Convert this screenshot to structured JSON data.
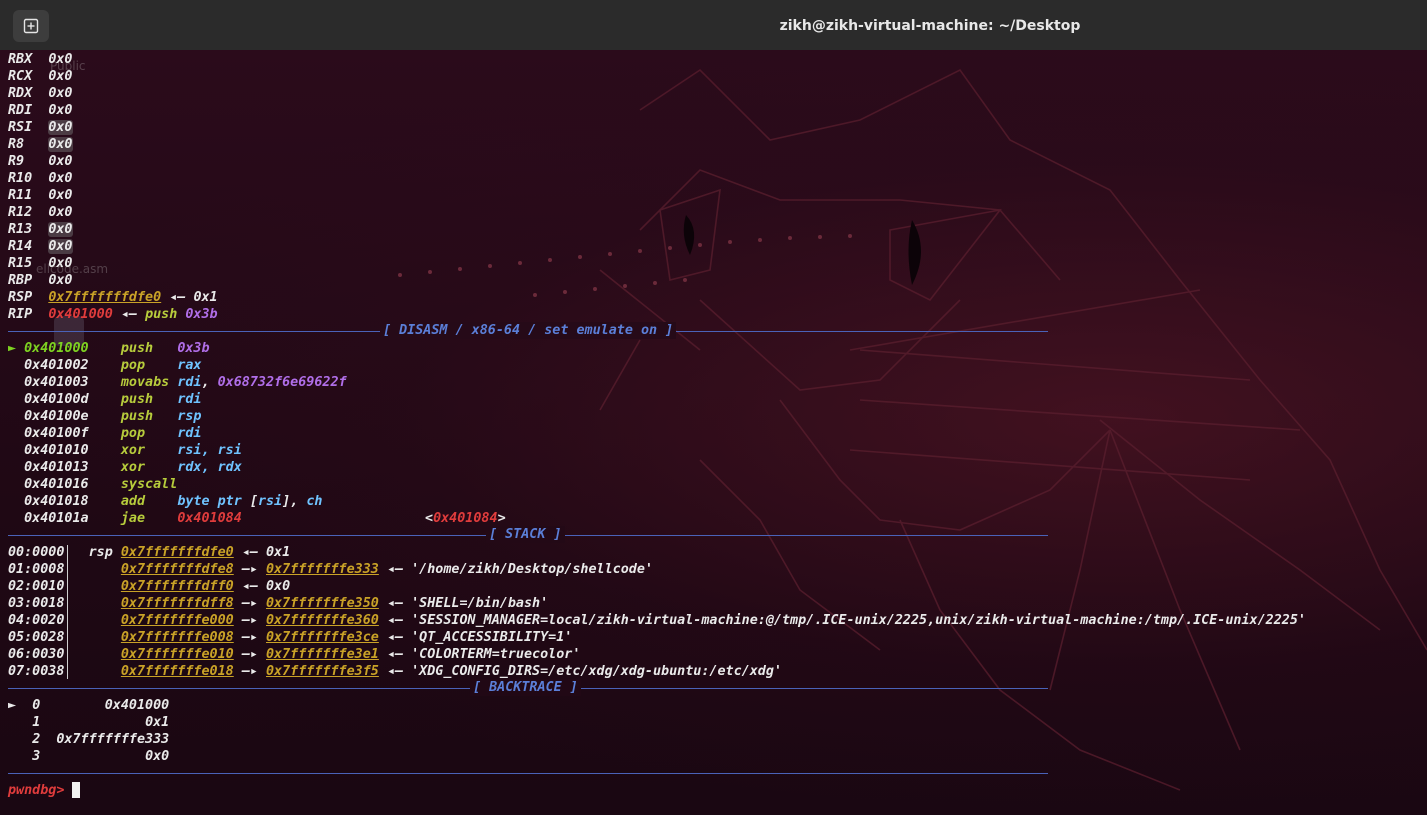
{
  "window": {
    "title": "zikh@zikh-virtual-machine: ~/Desktop",
    "new_tab_icon": "new-tab-icon"
  },
  "registers": [
    {
      "name": "RBX",
      "value": "0x0"
    },
    {
      "name": "RCX",
      "value": "0x0"
    },
    {
      "name": "RDX",
      "value": "0x0"
    },
    {
      "name": "RDI",
      "value": "0x0"
    },
    {
      "name": "RSI",
      "value": "0x0"
    },
    {
      "name": "R8",
      "value": "0x0"
    },
    {
      "name": "R9",
      "value": "0x0"
    },
    {
      "name": "R10",
      "value": "0x0"
    },
    {
      "name": "R11",
      "value": "0x0"
    },
    {
      "name": "R12",
      "value": "0x0"
    },
    {
      "name": "R13",
      "value": "0x0"
    },
    {
      "name": "R14",
      "value": "0x0"
    },
    {
      "name": "R15",
      "value": "0x0"
    },
    {
      "name": "RBP",
      "value": "0x0"
    }
  ],
  "rsp": {
    "name": "RSP",
    "value": "0x7fffffffdfe0",
    "arrow": "◂—",
    "deref": "0x1"
  },
  "rip": {
    "name": "RIP",
    "value": "0x401000",
    "arrow": "◂—",
    "op": "push",
    "arg": "0x3b"
  },
  "sections": {
    "disasm": "[ DISASM / x86-64 / set emulate on ]",
    "stack": "[ STACK ]",
    "backtrace": "[ BACKTRACE ]"
  },
  "disasm": [
    {
      "marker": "►",
      "addr": "0x401000",
      "mnem": "push",
      "ops": "0x3b",
      "current": true
    },
    {
      "marker": "",
      "addr": "0x401002",
      "mnem": "pop",
      "ops": "rax"
    },
    {
      "marker": "",
      "addr": "0x401003",
      "mnem": "movabs",
      "ops": "rdi, 0x68732f6e69622f"
    },
    {
      "marker": "",
      "addr": "0x40100d",
      "mnem": "push",
      "ops": "rdi"
    },
    {
      "marker": "",
      "addr": "0x40100e",
      "mnem": "push",
      "ops": "rsp"
    },
    {
      "marker": "",
      "addr": "0x40100f",
      "mnem": "pop",
      "ops": "rdi"
    },
    {
      "marker": "",
      "addr": "0x401010",
      "mnem": "xor",
      "ops": "rsi, rsi"
    },
    {
      "marker": "",
      "addr": "0x401013",
      "mnem": "xor",
      "ops": "rdx, rdx"
    },
    {
      "marker": "",
      "addr": "0x401016",
      "mnem": "syscall",
      "ops": ""
    },
    {
      "marker": "",
      "addr": "0x401018",
      "mnem": "add",
      "ops": "byte ptr [rsi], ch"
    },
    {
      "marker": "",
      "addr": "0x40101a",
      "mnem": "jae",
      "ops": "0x401084",
      "target": "<0x401084>"
    }
  ],
  "stack": [
    {
      "off": "00:0000",
      "reg": "rsp",
      "addr": "0x7fffffffdfe0",
      "arrow": "◂—",
      "ptr": "",
      "val": "0x1"
    },
    {
      "off": "01:0008",
      "reg": "",
      "addr": "0x7fffffffdfe8",
      "arrow": "—▸",
      "ptr": "0x7fffffffe333",
      "val": "'/home/zikh/Desktop/shellcode'"
    },
    {
      "off": "02:0010",
      "reg": "",
      "addr": "0x7fffffffdff0",
      "arrow": "◂—",
      "ptr": "",
      "val": "0x0"
    },
    {
      "off": "03:0018",
      "reg": "",
      "addr": "0x7fffffffdff8",
      "arrow": "—▸",
      "ptr": "0x7fffffffe350",
      "val": "'SHELL=/bin/bash'"
    },
    {
      "off": "04:0020",
      "reg": "",
      "addr": "0x7fffffffe000",
      "arrow": "—▸",
      "ptr": "0x7fffffffe360",
      "val": "'SESSION_MANAGER=local/zikh-virtual-machine:@/tmp/.ICE-unix/2225,unix/zikh-virtual-machine:/tmp/.ICE-unix/2225'"
    },
    {
      "off": "05:0028",
      "reg": "",
      "addr": "0x7fffffffe008",
      "arrow": "—▸",
      "ptr": "0x7fffffffe3ce",
      "val": "'QT_ACCESSIBILITY=1'"
    },
    {
      "off": "06:0030",
      "reg": "",
      "addr": "0x7fffffffe010",
      "arrow": "—▸",
      "ptr": "0x7fffffffe3e1",
      "val": "'COLORTERM=truecolor'"
    },
    {
      "off": "07:0038",
      "reg": "",
      "addr": "0x7fffffffe018",
      "arrow": "—▸",
      "ptr": "0x7fffffffe3f5",
      "val": "'XDG_CONFIG_DIRS=/etc/xdg/xdg-ubuntu:/etc/xdg'"
    }
  ],
  "backtrace": [
    {
      "marker": "►",
      "idx": "0",
      "addr": "0x401000"
    },
    {
      "marker": "",
      "idx": "1",
      "addr": "0x1"
    },
    {
      "marker": "",
      "idx": "2",
      "addr": "0x7fffffffe333"
    },
    {
      "marker": "",
      "idx": "3",
      "addr": "0x0"
    }
  ],
  "prompt": "pwndbg>",
  "desktop_ghost": {
    "label1": "Public",
    "label2": "ellcode.asm"
  }
}
